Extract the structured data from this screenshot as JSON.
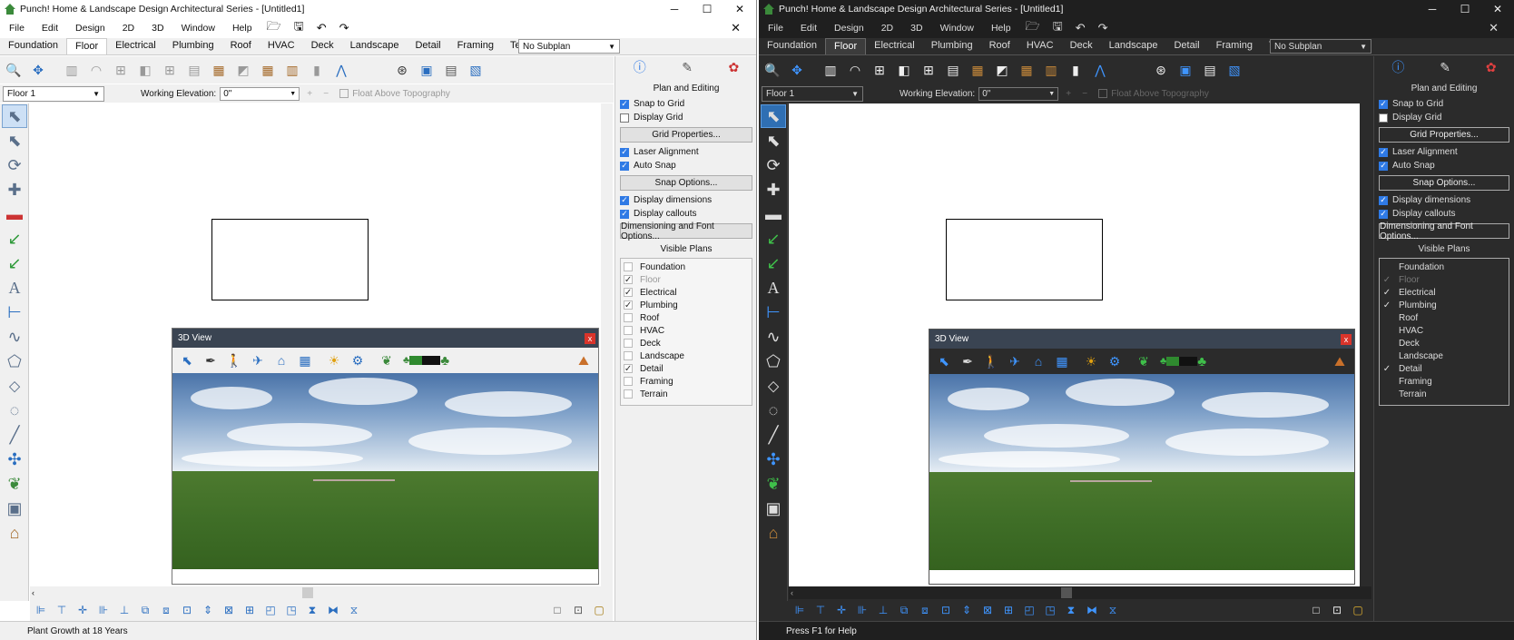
{
  "left": {
    "title": "Punch! Home & Landscape Design Architectural Series - [Untitled1]",
    "status": "Plant Growth at 18 Years"
  },
  "right": {
    "title": "Punch! Home & Landscape Design Architectural Series - [Untitled1]",
    "status": "Press F1 for Help"
  },
  "window_controls": {
    "minimize": "─",
    "maximize": "☐",
    "close": "✕"
  },
  "menu": [
    "File",
    "Edit",
    "Design",
    "2D",
    "3D",
    "Window",
    "Help"
  ],
  "menu_close": "✕",
  "tabs": [
    "Foundation",
    "Floor",
    "Electrical",
    "Plumbing",
    "Roof",
    "HVAC",
    "Deck",
    "Landscape",
    "Detail",
    "Framing",
    "Terrain"
  ],
  "active_tab": "Floor",
  "subplan": "No Subplan",
  "floor_select": "Floor 1",
  "working_elevation_label": "Working Elevation:",
  "working_elevation_value": "0\"",
  "float_label": "Float Above Topography",
  "panel": {
    "heading": "Plan and Editing",
    "snap_to_grid": "Snap to Grid",
    "display_grid": "Display Grid",
    "grid_properties": "Grid Properties...",
    "laser_alignment": "Laser Alignment",
    "auto_snap": "Auto Snap",
    "snap_options": "Snap Options...",
    "display_dimensions": "Display dimensions",
    "display_callouts": "Display callouts",
    "dim_font_options": "Dimensioning and Font Options...",
    "visible_plans_heading": "Visible Plans",
    "visible_plans": [
      {
        "name": "Foundation",
        "checked": false,
        "dim": false
      },
      {
        "name": "Floor",
        "checked": true,
        "dim": true
      },
      {
        "name": "Electrical",
        "checked": true,
        "dim": false
      },
      {
        "name": "Plumbing",
        "checked": true,
        "dim": false
      },
      {
        "name": "Roof",
        "checked": false,
        "dim": false
      },
      {
        "name": "HVAC",
        "checked": false,
        "dim": false
      },
      {
        "name": "Deck",
        "checked": false,
        "dim": false
      },
      {
        "name": "Landscape",
        "checked": false,
        "dim": false
      },
      {
        "name": "Detail",
        "checked": true,
        "dim": false
      },
      {
        "name": "Framing",
        "checked": false,
        "dim": false
      },
      {
        "name": "Terrain",
        "checked": false,
        "dim": false
      }
    ]
  },
  "view3d": {
    "title": "3D View",
    "close": "x"
  },
  "colors": {
    "accent": "#2f7ae5",
    "title3d": "#3a4452",
    "close_red": "#d9342b",
    "grass": "#3f6e27",
    "sky": "#7fa1c9"
  }
}
